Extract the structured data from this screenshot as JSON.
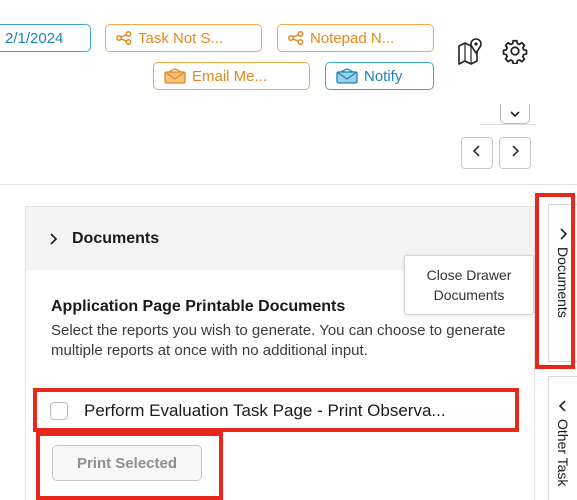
{
  "toolbar": {
    "chips": [
      {
        "label": "2/1/2024",
        "icon": "none",
        "color": "#1c84b5"
      },
      {
        "label": "Task Not S...",
        "icon": "share-icon",
        "color": "#e08a1f"
      },
      {
        "label": "Notepad N...",
        "icon": "share-icon",
        "color": "#e08a1f"
      },
      {
        "label": "Email Me...",
        "icon": "envelope-icon",
        "color": "#e08a1f"
      },
      {
        "label": "Notify",
        "icon": "envelope-icon",
        "color": "#1c84b5"
      }
    ],
    "icons": [
      "map-pin-icon",
      "gear-icon"
    ],
    "navigation": [
      "chevron-left-icon",
      "chevron-right-icon"
    ],
    "collapse_icon": "chevron-down-icon"
  },
  "panel": {
    "title": "Documents",
    "section_heading": "Application Page Printable Documents",
    "description": "Select the reports you wish to generate. You can choose to generate multiple reports at once with no additional input.",
    "documents": [
      {
        "label": "Perform Evaluation Task Page - Print Observa...",
        "checked": false
      }
    ],
    "print_button": "Print Selected"
  },
  "tooltip": {
    "line1": "Close Drawer",
    "line2": "Documents"
  },
  "drawer_tabs": [
    {
      "label": "Documents",
      "icon": "chevron-right-icon"
    },
    {
      "label": "Other Task",
      "icon": "chevron-left-icon"
    }
  ],
  "colors": {
    "orange_accent": "#e08a1f",
    "blue_accent": "#1c84b5",
    "highlight": "#e8271a"
  }
}
